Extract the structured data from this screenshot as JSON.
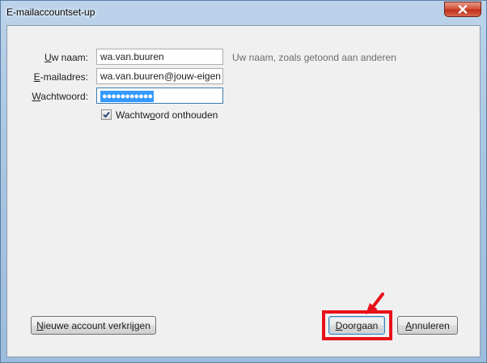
{
  "window": {
    "title": "E-mailaccountset-up"
  },
  "form": {
    "name": {
      "label_pre": "",
      "label_accel": "U",
      "label_post": "w naam:",
      "value": "wa.van.buuren",
      "hint": "Uw naam, zoals getoond aan anderen"
    },
    "email": {
      "label_pre": "",
      "label_accel": "E",
      "label_post": "-mailadres:",
      "value": "wa.van.buuren@jouw-eigen"
    },
    "password": {
      "label_pre": "",
      "label_accel": "W",
      "label_post": "achtwoord:",
      "value_masked": "●●●●●●●●●●●"
    },
    "remember": {
      "checked": true,
      "label_pre": "Wachtw",
      "label_accel": "o",
      "label_post": "ord onthouden"
    }
  },
  "buttons": {
    "new_account": {
      "pre": "",
      "accel": "N",
      "post": "ieuwe account verkrijgen"
    },
    "continue": {
      "pre": "",
      "accel": "D",
      "post": "oorgaan"
    },
    "cancel": {
      "pre": "",
      "accel": "A",
      "post": "nnuleren"
    }
  },
  "colors": {
    "highlight": "#e8101a",
    "selection": "#3399ff"
  },
  "icons": {
    "close": "close-icon",
    "check": "checkmark-icon",
    "annotation": "red-arrow-icon"
  }
}
